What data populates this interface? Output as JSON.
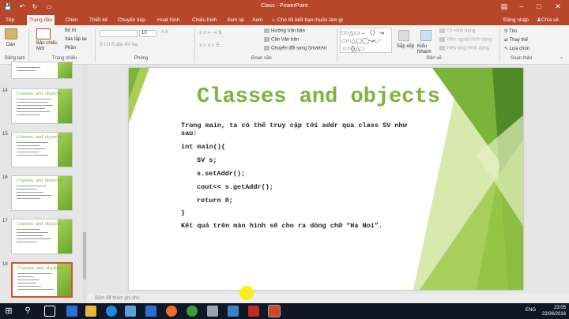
{
  "window": {
    "title": "Class - PowerPoint",
    "minimize_icon": "minimize-icon",
    "maximize_icon": "maximize-icon",
    "close_icon": "close-icon"
  },
  "quick_access": [
    "save-icon",
    "undo-icon",
    "redo-icon",
    "present-icon"
  ],
  "tabs": [
    {
      "label": "Tệp"
    },
    {
      "label": "Trang đầu"
    },
    {
      "label": "Chèn"
    },
    {
      "label": "Thiết kế"
    },
    {
      "label": "Chuyển tiếp"
    },
    {
      "label": "Hoạt hình"
    },
    {
      "label": "Chiếu hình"
    },
    {
      "label": "Xem lại"
    },
    {
      "label": "Xem"
    }
  ],
  "tell_me": "Cho tôi biết bạn muốn làm gì",
  "account": {
    "login": "Đăng nhập",
    "share": "Chia sẻ"
  },
  "ribbon": {
    "clipboard": {
      "paste": "Dán",
      "cut": "Cắt",
      "copy": "Sao chép",
      "format": "Bản sao"
    },
    "slides": {
      "new_slide": "Bản chiếu Mới",
      "layout": "Bố trí",
      "reset": "Xác lập lại",
      "section": "Phần"
    },
    "font": {
      "size": "10"
    },
    "paragraph": {
      "text_direction": "Hướng Văn bản",
      "align_text": "Căn Văn bản",
      "smartart": "Chuyển đổi sang SmartArt"
    },
    "drawing": {
      "arrange": "Sắp xếp",
      "quick_styles": "Kiểu Nhanh",
      "fill": "Tô Hình dạng",
      "outline": "Viền ngoài Hình dạng",
      "effects": "Hiệu ứng Hình dạng"
    },
    "editing": {
      "find": "Tìm",
      "replace": "Thay thế",
      "select": "Lựa chọn"
    },
    "groups": [
      "Bảng tạm",
      "Trang chiếu",
      "Phông",
      "Đoạn văn",
      "Bản vẽ",
      "Soạn thảo"
    ]
  },
  "thumbnails": [
    {
      "number": "14",
      "title": "Classes and objects"
    },
    {
      "number": "15",
      "title": "Classes and objects"
    },
    {
      "number": "16",
      "title": "Classes and objects"
    },
    {
      "number": "17",
      "title": "Classes and objects"
    },
    {
      "number": "18",
      "title": "Classes and objects"
    }
  ],
  "slide": {
    "title": "Classes and objects",
    "lines": [
      "Trong main, ta có thể truy cập tới addr qua class SV như",
      "sau:",
      "int main(){",
      "SV s;",
      "s.setAddr();",
      "cout<< s.getAddr();",
      "return 0;",
      "}",
      "Kết quả trên màn hình sẽ cho ra dòng chữ “Ha Noi”."
    ]
  },
  "notes_placeholder": "Bấm để thêm ghi chú",
  "taskbar": {
    "language": "ENG",
    "time": "23:05",
    "date": "22/06/2016"
  },
  "colors": {
    "accent": "#b7472a",
    "slide_green": "#7ab43a"
  }
}
